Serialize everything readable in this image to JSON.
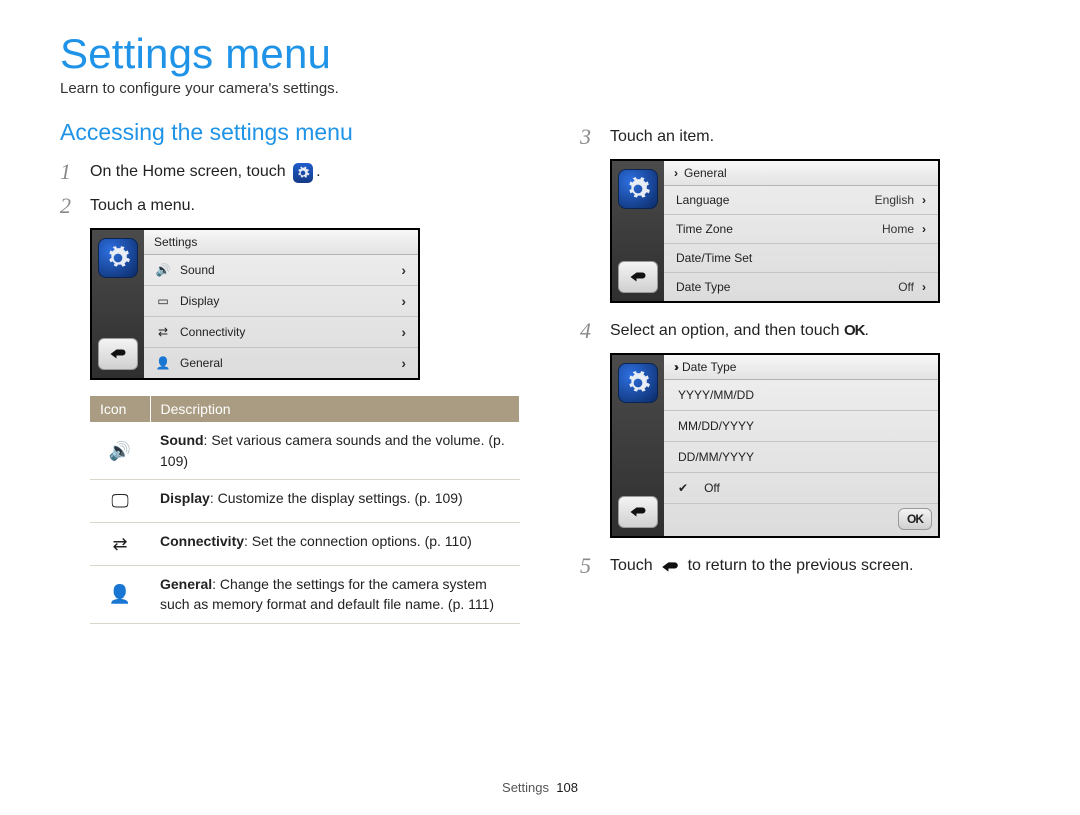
{
  "page": {
    "title": "Settings menu",
    "subtitle": "Learn to configure your camera's settings.",
    "footer_section": "Settings",
    "footer_page": "108"
  },
  "left": {
    "section_title": "Accessing the settings menu",
    "steps": {
      "s1_num": "1",
      "s1_pre": "On the Home screen, touch ",
      "s1_post": ".",
      "s2_num": "2",
      "s2_text": "Touch a menu."
    },
    "lcd1": {
      "title": "Settings",
      "rows": [
        {
          "label": "Sound"
        },
        {
          "label": "Display"
        },
        {
          "label": "Connectivity"
        },
        {
          "label": "General"
        }
      ]
    },
    "table": {
      "head_icon": "Icon",
      "head_desc": "Description",
      "rows": [
        {
          "bold": "Sound",
          "text": ": Set various camera sounds and the volume. (p. 109)"
        },
        {
          "bold": "Display",
          "text": ": Customize the display settings. (p. 109)"
        },
        {
          "bold": "Connectivity",
          "text": ": Set the connection options. (p. 110)"
        },
        {
          "bold": "General",
          "text": ": Change the settings for the camera system such as memory format and default file name. (p. 111)"
        }
      ]
    }
  },
  "right": {
    "steps": {
      "s3_num": "3",
      "s3_text": "Touch an item.",
      "s4_num": "4",
      "s4_pre": "Select an option, and then touch ",
      "s4_post": ".",
      "s5_num": "5",
      "s5_pre": "Touch ",
      "s5_post": " to return to the previous screen."
    },
    "lcd2": {
      "breadcrumb": "General",
      "rows": [
        {
          "label": "Language",
          "value": "English",
          "chev": true
        },
        {
          "label": "Time Zone",
          "value": "Home",
          "chev": true
        },
        {
          "label": "Date/Time Set",
          "value": "",
          "chev": false
        },
        {
          "label": "Date Type",
          "value": "Off",
          "chev": true
        }
      ]
    },
    "lcd3": {
      "breadcrumb": "Date Type",
      "options": [
        {
          "label": "YYYY/MM/DD",
          "selected": false
        },
        {
          "label": "MM/DD/YYYY",
          "selected": false
        },
        {
          "label": "DD/MM/YYYY",
          "selected": false
        },
        {
          "label": "Off",
          "selected": true
        }
      ],
      "ok_label": "OK"
    },
    "ok_inline": "OK"
  }
}
